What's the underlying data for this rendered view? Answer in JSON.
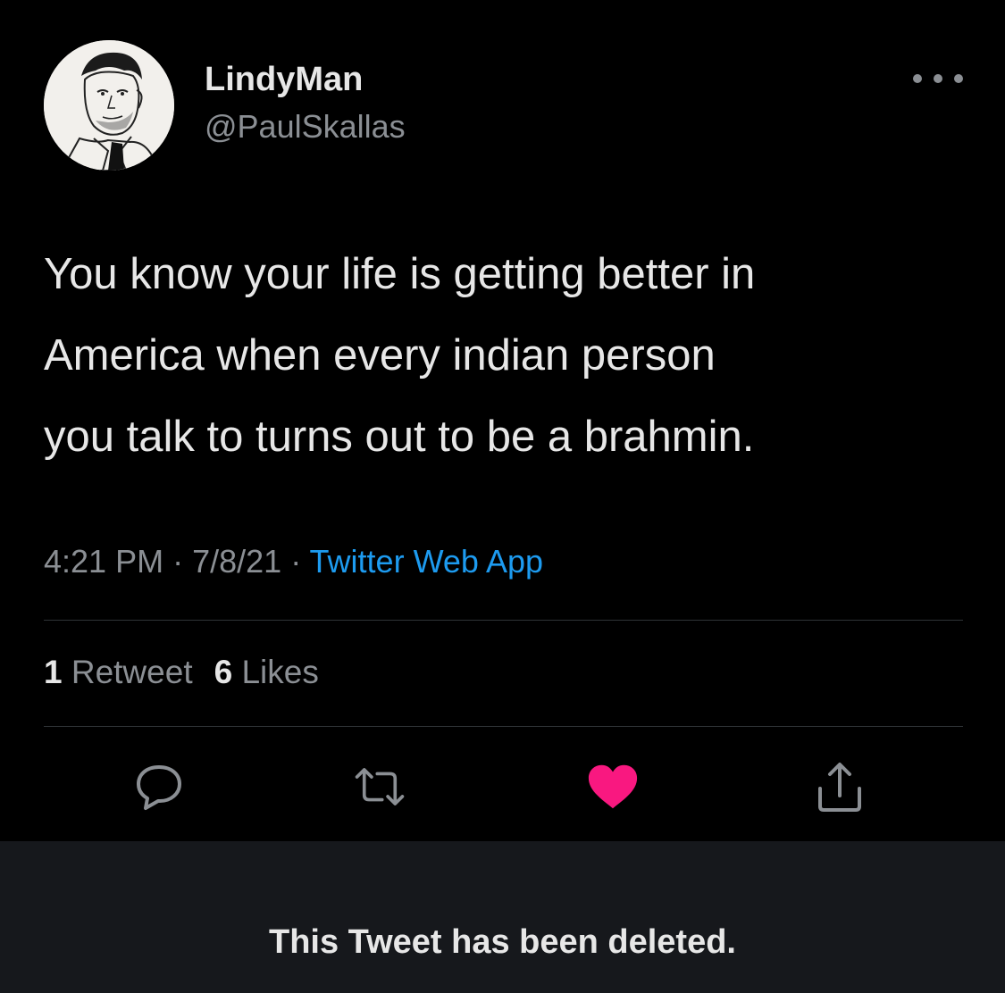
{
  "tweet": {
    "display_name": "LindyMan",
    "handle": "@PaulSkallas",
    "more_icon": "more-horizontal-icon",
    "text_lines": [
      "You know your life is getting better in",
      "America when every indian person",
      "you talk to turns out to be a brahmin."
    ],
    "time": "4:21 PM",
    "separator": "·",
    "date": "7/8/21",
    "source": "Twitter Web App",
    "stats": {
      "retweets_count": "1",
      "retweets_label": "Retweet",
      "likes_count": "6",
      "likes_label": "Likes"
    },
    "actions": [
      {
        "icon": "reply-icon"
      },
      {
        "icon": "retweet-icon"
      },
      {
        "icon": "heart-icon",
        "liked": true
      },
      {
        "icon": "share-icon"
      }
    ]
  },
  "deleted_notice": "This Tweet has been deleted.",
  "colors": {
    "background": "#000000",
    "text_primary": "#e7e7e7",
    "text_secondary": "#8b8f94",
    "link": "#1d9bf0",
    "like": "#f91880",
    "divider": "#2f3336",
    "notice_background": "#16181c"
  }
}
